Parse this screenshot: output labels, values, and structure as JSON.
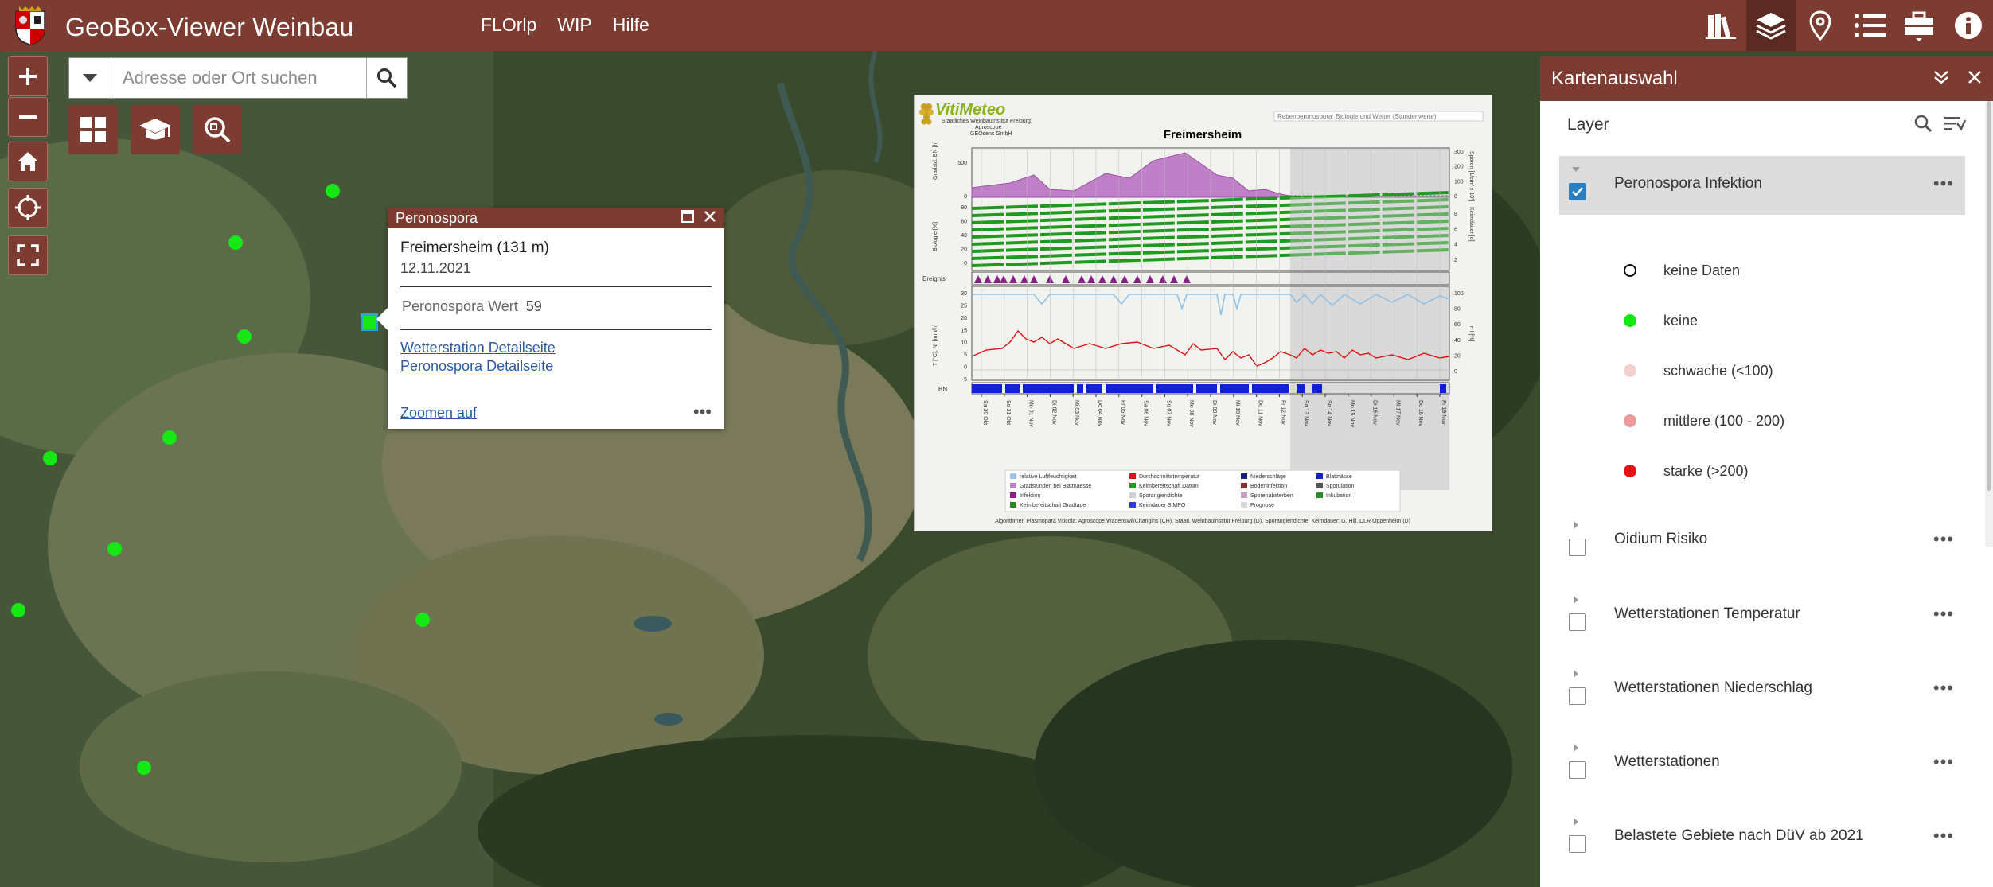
{
  "header": {
    "app_title": "GeoBox-Viewer Weinbau",
    "nav": [
      "FLOrlp",
      "WIP",
      "Hilfe"
    ],
    "icons": [
      "books-icon",
      "layers-icon",
      "map-marker-icon",
      "list-icon",
      "toolbox-icon",
      "info-icon"
    ],
    "active_icon": "layers-icon",
    "bg_color": "#7d3c32"
  },
  "map": {
    "search_placeholder": "Adresse oder Ort suchen"
  },
  "popup": {
    "title": "Peronospora",
    "station": "Freimersheim (131 m)",
    "date": "12.11.2021",
    "value_label": "Peronospora Wert",
    "value": "59",
    "link_station": "Wetterstation Detailseite",
    "link_peronospora": "Peronospora Detailseite",
    "zoom": "Zoomen auf"
  },
  "chart": {
    "brand": "VitiMeteo",
    "org1": "Staatliches Weinbauinstitut Freiburg",
    "org2": "Agroscope",
    "org3": "GEOsens GmbH",
    "subtitle_box": "Rebenperonospora: Biologie und Wetter (Stundenwerte)",
    "title": "Freimersheim",
    "ylabel_top_left": "Gradstd. BN [h]",
    "ylabel_top_right": "Sporen [1/cm² x 10³]",
    "ylabel_bio": "Biologie [%]",
    "ylabel_bio_right": "Keimdauer [d]",
    "ylabel_event": "Ereignis",
    "ylabel_temp": "T [°C], N. [mm/h]",
    "ylabel_rh": "rH [%]",
    "ylabel_bn": "BN",
    "dates": [
      "Sa 30 Okt",
      "So 31 Okt",
      "Mo 01 Nov",
      "Di 02 Nov",
      "Mi 03 Nov",
      "Do 04 Nov",
      "Fr 05 Nov",
      "Sa 06 Nov",
      "So 07 Nov",
      "Mo 08 Nov",
      "Di 09 Nov",
      "Mi 10 Nov",
      "Do 11 Nov",
      "Fr 12 Nov",
      "Sa 13 Nov",
      "So 14 Nov",
      "Mo 15 Nov",
      "Di 16 Nov",
      "Mi 17 Nov",
      "Do 18 Nov",
      "Fr 19 Nov"
    ],
    "legend": [
      "relative Luftfeuchtigkeit",
      "Durchschnittstemperatur",
      "Niederschläge",
      "Blattnässe",
      "Gradstunden bei Blattnaesse",
      "Keimbereitschaft Datum",
      "Bodeninfektion",
      "Sporulation",
      "Infektion",
      "Sporangiendichte",
      "Sporenabsterben",
      "Inkubation",
      "Keimbereitschaft Gradtage",
      "Keimdauer SIMPO",
      "Prognose"
    ],
    "footer": "Algorithmen Plasmopara Viticola: Agroscope Wädenswil/Changins (CH), Staatl. Weinbauinstitut Freiburg (D), Sporangiendichte, Keimdauer: G. Hill, DLR Oppenheim (D)",
    "ticks_gradstd": [
      "500",
      "0"
    ],
    "ticks_sporen": [
      "300",
      "200",
      "100",
      "0"
    ],
    "ticks_bio": [
      "80",
      "60",
      "40",
      "20",
      "0"
    ],
    "ticks_keim": [
      "8",
      "6",
      "4",
      "2"
    ],
    "ticks_temp": [
      "30",
      "25",
      "20",
      "15",
      "10",
      "5",
      "0",
      "-5"
    ],
    "ticks_rh": [
      "100",
      "80",
      "60",
      "40",
      "20",
      "0"
    ]
  },
  "side_panel": {
    "title": "Kartenauswahl",
    "subtitle": "Layer",
    "layers": [
      {
        "label": "Peronospora Infektion",
        "checked": true
      },
      {
        "label": "Oidium Risiko",
        "checked": false
      },
      {
        "label": "Wetterstationen Temperatur",
        "checked": false
      },
      {
        "label": "Wetterstationen Niederschlag",
        "checked": false
      },
      {
        "label": "Wetterstationen",
        "checked": false
      },
      {
        "label": "Belastete Gebiete nach DüV ab 2021",
        "checked": false
      }
    ],
    "legend": [
      {
        "label": "keine Daten",
        "color": "#ffffff"
      },
      {
        "label": "keine",
        "color": "#15e815"
      },
      {
        "label": "schwache (<100)",
        "color": "#f5d0d0"
      },
      {
        "label": "mittlere (100 - 200)",
        "color": "#ee9a9a"
      },
      {
        "label": "starke (>200)",
        "color": "#e81010"
      }
    ]
  }
}
